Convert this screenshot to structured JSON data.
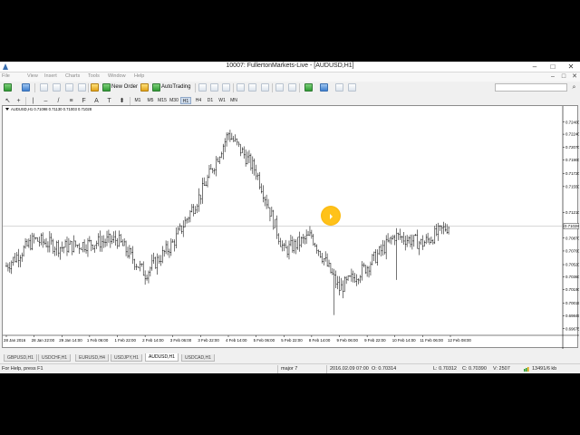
{
  "window": {
    "title": "10007: FullertonMarkets-Live - [AUDUSD,H1]",
    "buttons": [
      "–",
      "□",
      "✕"
    ]
  },
  "menu": {
    "items": [
      "File",
      "View",
      "Insert",
      "Charts",
      "Tools",
      "Window",
      "Help"
    ],
    "mdi_buttons": [
      "–",
      "□",
      "✕"
    ]
  },
  "toolbar": {
    "new_order_label": "New Order",
    "autotrading_label": "AutoTrading",
    "search_placeholder": ""
  },
  "timeframes": {
    "items": [
      "M1",
      "M5",
      "M15",
      "M30",
      "H1",
      "H4",
      "D1",
      "W1",
      "MN"
    ],
    "active": "H1"
  },
  "chart": {
    "header": "AUDUSD,H1  0.71098 0.71130 0.71003 0.71028",
    "current_price_label": "0.71028",
    "price_labels": [
      "0.72400",
      "0.72240",
      "0.72070",
      "0.71900",
      "0.71720",
      "0.71550",
      "0.71210",
      "0.71028",
      "0.70870",
      "0.70700",
      "0.70520",
      "0.70360",
      "0.70190",
      "0.70015",
      "0.69845",
      "0.69675"
    ],
    "time_labels": [
      "28 Jan 2016",
      "28 Jan 22:00",
      "29 Jan 14:00",
      "1 Feb 06:00",
      "1 Feb 22:00",
      "2 Feb 14:00",
      "3 Feb 06:00",
      "3 Feb 22:00",
      "4 Feb 14:00",
      "5 Feb 06:00",
      "5 Feb 22:00",
      "8 Feb 14:00",
      "9 Feb 06:00",
      "9 Feb 22:00",
      "10 Feb 14:00",
      "11 Feb 06:00",
      "12 Feb 08:00"
    ]
  },
  "chart_data": {
    "type": "line",
    "title": "AUDUSD,H1",
    "symbol": "AUDUSD",
    "timeframe": "H1",
    "ohlc": {
      "open": 0.71098,
      "high": 0.7113,
      "low": 0.71003,
      "close": 0.71028
    },
    "ylim": [
      0.696,
      0.7254
    ],
    "x": [
      "28 Jan 2016",
      "28 Jan 22:00",
      "29 Jan 14:00",
      "1 Feb 06:00",
      "1 Feb 22:00",
      "2 Feb 14:00",
      "3 Feb 06:00",
      "3 Feb 22:00",
      "4 Feb 14:00",
      "5 Feb 06:00",
      "5 Feb 22:00",
      "8 Feb 14:00",
      "9 Feb 06:00",
      "9 Feb 22:00",
      "10 Feb 14:00",
      "11 Feb 06:00",
      "12 Feb 08:00"
    ],
    "series": [
      {
        "values": [
          0.705,
          0.7085,
          0.7075,
          0.708,
          0.7085,
          0.704,
          0.708,
          0.7145,
          0.7225,
          0.7175,
          0.707,
          0.709,
          0.702,
          0.705,
          0.709,
          0.708,
          0.7105
        ]
      }
    ]
  },
  "tabs": {
    "items": [
      "GBPUSD,H1",
      "USDCHF,H1",
      "EURUSD,H4",
      "USDJPY,H1",
      "AUDUSD,H1",
      "USDCAD,H1"
    ],
    "active": "AUDUSD,H1"
  },
  "status": {
    "help": "For Help, press F1",
    "profile": "major 7",
    "datetime": "2016.02.09 07:00",
    "open": "O: 0.70314",
    "low": "L: 0.70312",
    "close": "C: 0.70390",
    "volume": "V: 2507",
    "traffic": "13491/6 kb"
  },
  "colors": {
    "candle_stroke": "#000000",
    "chart_bg": "#ffffff",
    "cursor_highlight": "#ffc21a",
    "price_line": "#c0c0c0"
  }
}
